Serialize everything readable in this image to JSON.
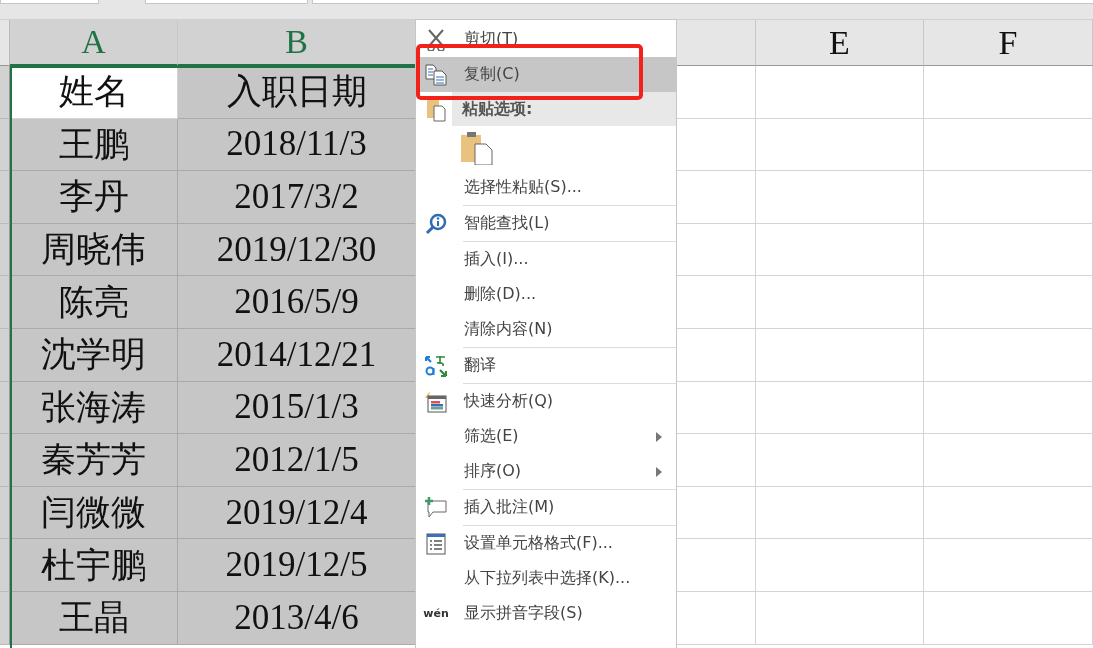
{
  "columns": [
    "A",
    "B",
    "E",
    "F"
  ],
  "rows": [
    {
      "cells": [
        {
          "text": "姓名",
          "selected": false
        },
        {
          "text": "入职日期",
          "selected": true
        }
      ]
    },
    {
      "cells": [
        {
          "text": "王鹏",
          "selected": true
        },
        {
          "text": "2018/11/3",
          "selected": true
        }
      ]
    },
    {
      "cells": [
        {
          "text": "李丹",
          "selected": true
        },
        {
          "text": "2017/3/2",
          "selected": true
        }
      ]
    },
    {
      "cells": [
        {
          "text": "周晓伟",
          "selected": true
        },
        {
          "text": "2019/12/30",
          "selected": true
        }
      ]
    },
    {
      "cells": [
        {
          "text": "陈亮",
          "selected": true
        },
        {
          "text": "2016/5/9",
          "selected": true
        }
      ]
    },
    {
      "cells": [
        {
          "text": "沈学明",
          "selected": true
        },
        {
          "text": "2014/12/21",
          "selected": true
        }
      ]
    },
    {
      "cells": [
        {
          "text": "张海涛",
          "selected": true
        },
        {
          "text": "2015/1/3",
          "selected": true
        }
      ]
    },
    {
      "cells": [
        {
          "text": "秦芳芳",
          "selected": true
        },
        {
          "text": "2012/1/5",
          "selected": true
        }
      ]
    },
    {
      "cells": [
        {
          "text": "闫微微",
          "selected": true
        },
        {
          "text": "2019/12/4",
          "selected": true
        }
      ]
    },
    {
      "cells": [
        {
          "text": "杜宇鹏",
          "selected": true
        },
        {
          "text": "2019/12/5",
          "selected": true
        }
      ]
    },
    {
      "cells": [
        {
          "text": "王晶",
          "selected": true
        },
        {
          "text": "2013/4/6",
          "selected": true
        }
      ]
    }
  ],
  "context_menu": {
    "items": [
      {
        "kind": "item",
        "label": "剪切(T)",
        "selected": false,
        "submenu": false
      },
      {
        "kind": "item",
        "label": "复制(C)",
        "selected": true,
        "submenu": false
      },
      {
        "kind": "header",
        "label": "粘贴选项:"
      },
      {
        "kind": "paste-options"
      },
      {
        "kind": "item",
        "label": "选择性粘贴(S)...",
        "selected": false,
        "submenu": false
      },
      {
        "kind": "separator"
      },
      {
        "kind": "item",
        "label": "智能查找(L)",
        "selected": false,
        "submenu": false
      },
      {
        "kind": "separator"
      },
      {
        "kind": "item",
        "label": "插入(I)...",
        "selected": false,
        "submenu": false
      },
      {
        "kind": "item",
        "label": "删除(D)...",
        "selected": false,
        "submenu": false
      },
      {
        "kind": "item",
        "label": "清除内容(N)",
        "selected": false,
        "submenu": false
      },
      {
        "kind": "separator"
      },
      {
        "kind": "item",
        "label": "翻译",
        "selected": false,
        "submenu": false
      },
      {
        "kind": "separator"
      },
      {
        "kind": "item",
        "label": "快速分析(Q)",
        "selected": false,
        "submenu": false
      },
      {
        "kind": "item",
        "label": "筛选(E)",
        "selected": false,
        "submenu": true
      },
      {
        "kind": "item",
        "label": "排序(O)",
        "selected": false,
        "submenu": true
      },
      {
        "kind": "separator"
      },
      {
        "kind": "item",
        "label": "插入批注(M)",
        "selected": false,
        "submenu": false
      },
      {
        "kind": "separator"
      },
      {
        "kind": "item",
        "label": "设置单元格格式(F)...",
        "selected": false,
        "submenu": false
      },
      {
        "kind": "item",
        "label": "从下拉列表中选择(K)...",
        "selected": false,
        "submenu": false
      },
      {
        "kind": "item",
        "label": "显示拼音字段(S)",
        "selected": false,
        "submenu": false,
        "icon_text": "wén"
      }
    ],
    "highlight": {
      "kind": "red-outline"
    }
  }
}
